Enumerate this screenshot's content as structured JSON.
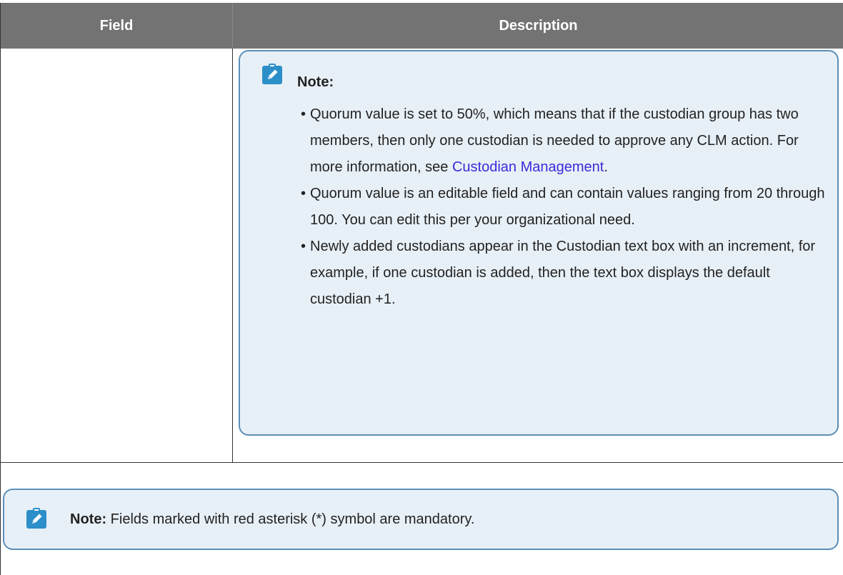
{
  "table": {
    "headers": {
      "field": "Field",
      "description": "Description"
    }
  },
  "note_main": {
    "icon": "pencil-clipboard-icon",
    "title": "Note:",
    "items": [
      {
        "text": "Quorum value is set to 50%, which means that if the custodian group has two members, then only one custodian is needed to approve any CLM action. For more information, see ",
        "link_text": "Custodian Management",
        "suffix": "."
      },
      {
        "text": "Quorum value is an editable field and can contain values ranging from 20 through 100. You can edit this per your organizational need."
      },
      {
        "text": "Newly added custodians appear in the Custodian text box with an increment, for example, if one custodian is added, then the text box displays the default custodian +1."
      }
    ]
  },
  "note_footer": {
    "icon": "pencil-clipboard-icon",
    "label": "Note:",
    "text": " Fields marked with red asterisk (*) symbol are mandatory."
  },
  "colors": {
    "header_bg": "#737373",
    "note_bg": "#e8f0f7",
    "note_border": "#5b8fb9",
    "icon_bg": "#2c8fc9",
    "link": "#3a2ad8"
  }
}
